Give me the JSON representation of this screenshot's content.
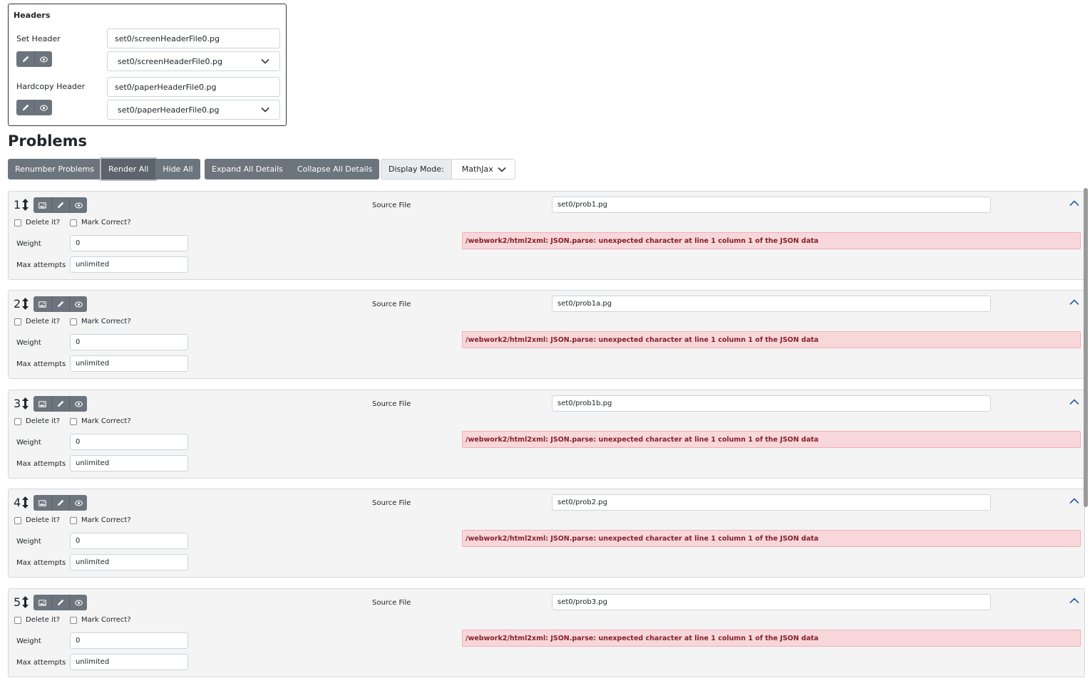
{
  "headers": {
    "title": "Headers",
    "set_header": {
      "label": "Set Header",
      "input_value": "set0/screenHeaderFile0.pg",
      "select_value": "set0/screenHeaderFile0.pg"
    },
    "hardcopy_header": {
      "label": "Hardcopy Header",
      "input_value": "set0/paperHeaderFile0.pg",
      "select_value": "set0/paperHeaderFile0.pg"
    }
  },
  "problems_title": "Problems",
  "toolbar": {
    "renumber": "Renumber Problems",
    "render_all": "Render All",
    "hide_all": "Hide All",
    "expand_all": "Expand All Details",
    "collapse_all": "Collapse All Details",
    "display_mode_label": "Display Mode:",
    "display_mode_value": "MathJax"
  },
  "labels": {
    "source_file": "Source File",
    "delete": "Delete it?",
    "mark_correct": "Mark Correct?",
    "weight": "Weight",
    "max_attempts": "Max attempts"
  },
  "problems": [
    {
      "number": "1",
      "source": "set0/prob1.pg",
      "weight": "0",
      "max_attempts": "unlimited",
      "error": "/webwork2/html2xml: JSON.parse: unexpected character at line 1 column 1 of the JSON data"
    },
    {
      "number": "2",
      "source": "set0/prob1a.pg",
      "weight": "0",
      "max_attempts": "unlimited",
      "error": "/webwork2/html2xml: JSON.parse: unexpected character at line 1 column 1 of the JSON data"
    },
    {
      "number": "3",
      "source": "set0/prob1b.pg",
      "weight": "0",
      "max_attempts": "unlimited",
      "error": "/webwork2/html2xml: JSON.parse: unexpected character at line 1 column 1 of the JSON data"
    },
    {
      "number": "4",
      "source": "set0/prob2.pg",
      "weight": "0",
      "max_attempts": "unlimited",
      "error": "/webwork2/html2xml: JSON.parse: unexpected character at line 1 column 1 of the JSON data"
    },
    {
      "number": "5",
      "source": "set0/prob3.pg",
      "weight": "0",
      "max_attempts": "unlimited",
      "error": "/webwork2/html2xml: JSON.parse: unexpected character at line 1 column 1 of the JSON data"
    }
  ],
  "icons": {
    "edit": "pencil-icon",
    "view": "eye-icon",
    "image": "image-icon",
    "move": "arrows-vertical-icon",
    "collapse": "chevron-up-icon",
    "dropdown": "chevron-down-icon"
  }
}
